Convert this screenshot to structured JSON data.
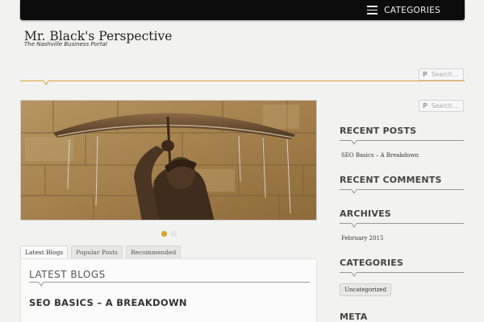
{
  "nav": {
    "menu_label": "CATEGORIES",
    "menu_icon": "hamburger-icon"
  },
  "header": {
    "site_title": "Mr. Black's Perspective",
    "tagline": "The Nashville Business Portal",
    "search_placeholder": "Search..."
  },
  "slider": {
    "slide_count": 2,
    "active_slide": 1
  },
  "tabs": [
    {
      "label": "Latest Blogs",
      "active": true
    },
    {
      "label": "Popular Posts",
      "active": false
    },
    {
      "label": "Recommended",
      "active": false
    }
  ],
  "tab_panel": {
    "heading": "LATEST BLOGS",
    "post_title": "SEO BASICS – A BREAKDOWN"
  },
  "sidebar": {
    "search_placeholder": "Search...",
    "recent_posts": {
      "title": "RECENT POSTS",
      "items": [
        "SEO Basics – A Breakdown"
      ]
    },
    "recent_comments": {
      "title": "RECENT COMMENTS"
    },
    "archives": {
      "title": "ARCHIVES",
      "items": [
        "February 2015"
      ]
    },
    "categories": {
      "title": "CATEGORIES",
      "items": [
        "Uncategorized"
      ]
    },
    "meta": {
      "title": "META"
    }
  },
  "colors": {
    "accent": "#d9a940",
    "topbar": "#0c0c0c",
    "background": "#f2f2f0"
  }
}
